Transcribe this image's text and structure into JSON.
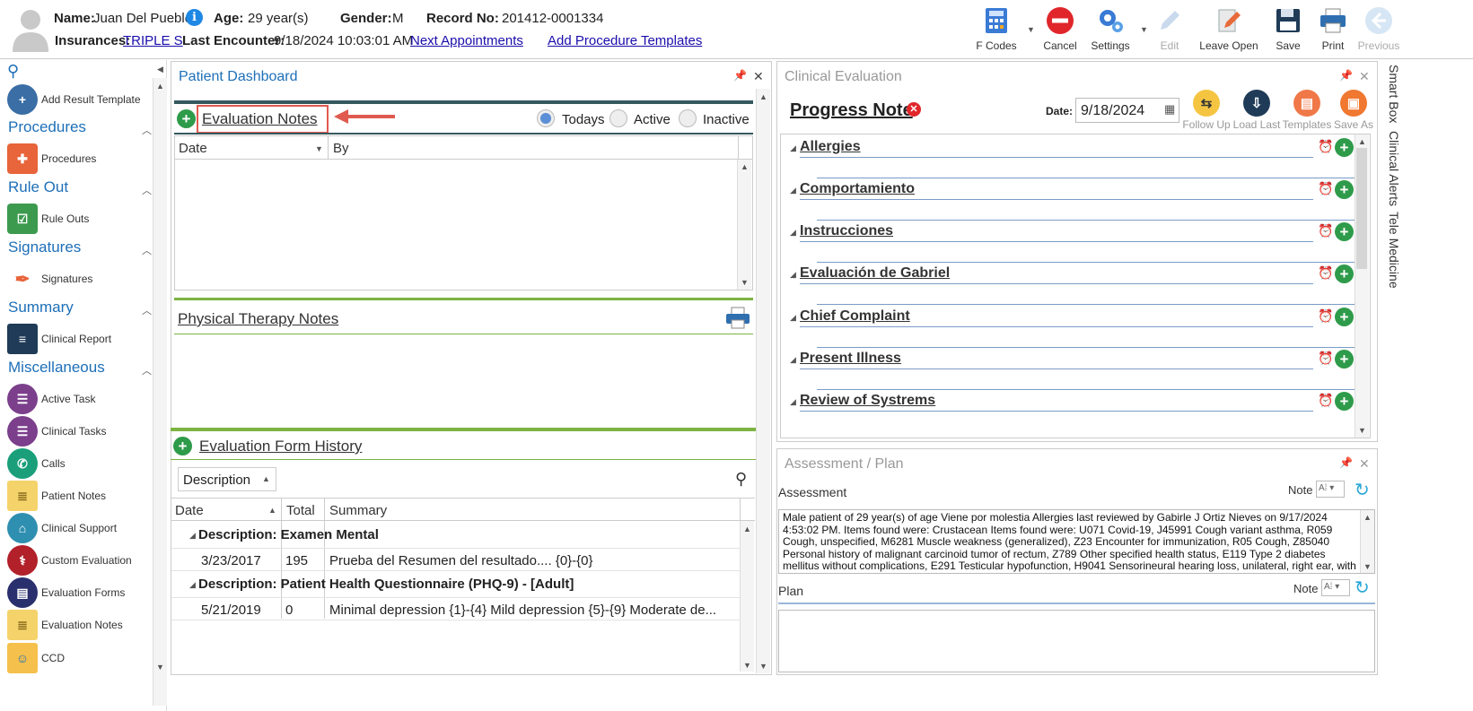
{
  "header": {
    "name_label": "Name:",
    "name": "Juan Del Pueblo",
    "age_label": "Age:",
    "age": "29 year(s)",
    "gender_label": "Gender:",
    "gender": "M",
    "record_label": "Record No:",
    "record": "201412-0001334",
    "insurances_label": "Insurances:",
    "insurance": "TRIPLE S",
    "last_encounter_label": "Last Encounter:",
    "last_encounter": "9/18/2024 10:03:01 AM",
    "next_appointments": "Next Appointments",
    "add_procedure_templates": "Add Procedure Templates"
  },
  "toolbar": {
    "fcodes": "F Codes",
    "cancel": "Cancel",
    "settings": "Settings",
    "edit": "Edit",
    "leave_open": "Leave Open",
    "save": "Save",
    "print": "Print",
    "previous": "Previous"
  },
  "sidebar": {
    "add_result_template": "Add Result Template",
    "sections": [
      {
        "title": "Procedures",
        "item": "Procedures"
      },
      {
        "title": "Rule Out",
        "item": "Rule Outs"
      },
      {
        "title": "Signatures",
        "item": "Signatures"
      },
      {
        "title": "Summary",
        "item": "Clinical Report"
      },
      {
        "title": "Miscellaneous",
        "item": "Active Task"
      }
    ],
    "misc_items": [
      "Clinical Tasks",
      "Calls",
      "Patient Notes",
      "Clinical Support",
      "Custom Evaluation",
      "Evaluation Forms",
      "Evaluation Notes",
      "CCD"
    ]
  },
  "dashboard": {
    "title": "Patient Dashboard",
    "evaluation_notes": "Evaluation Notes",
    "filter_todays": "Todays",
    "filter_active": "Active",
    "filter_inactive": "Inactive",
    "col_date": "Date",
    "col_by": "By",
    "physical_therapy_notes": "Physical Therapy Notes",
    "evaluation_form_history": "Evaluation Form History",
    "group_dropdown": "Description",
    "hist_col_date": "Date",
    "hist_col_total": "Total",
    "hist_col_summary": "Summary",
    "groups": [
      {
        "label": "Description: Examen Mental",
        "date": "3/23/2017",
        "total": "195",
        "summary": "Prueba del Resumen del resultado.... {0}-{0}"
      },
      {
        "label": "Description: Patient Health Questionnaire (PHQ-9) - [Adult]",
        "date": "5/21/2019",
        "total": "0",
        "summary": "Minimal depression {1}-{4}  Mild depression {5}-{9}  Moderate de..."
      }
    ]
  },
  "clinical": {
    "title": "Clinical Evaluation",
    "note_title": "Progress Note",
    "date_label": "Date:",
    "date": "9/18/2024",
    "follow_up": "Follow Up",
    "load_last": "Load Last",
    "templates": "Templates",
    "save_as": "Save As",
    "sections": [
      "Allergies",
      "Comportamiento",
      "Instrucciones",
      "Evaluación de Gabriel",
      "Chief Complaint",
      "Present Illness",
      "Review of Systrems"
    ]
  },
  "assessment": {
    "title": "Assessment / Plan",
    "assessment_label": "Assessment",
    "note_label": "Note",
    "assessment_text": "Male patient of 29 year(s) of age Viene por molestia     Allergies last reviewed by Gabirle J Ortiz Nieves on 9/17/2024 4:53:02 PM.    Items found were:  Crustacean  Items found were:  U071 Covid-19, J45991 Cough variant asthma, R059 Cough, unspecified, M6281 Muscle weakness (generalized), Z23 Encounter for immunization, R05 Cough, Z85040 Personal history of malignant carcinoid tumor of rectum, Z789 Other specified health status, E119 Type 2 diabetes mellitus without complications, E291 Testicular hypofunction, H9041 Sensorineural hearing loss, unilateral, right ear, with",
    "plan_label": "Plan",
    "plan_note_label": "Note"
  },
  "right_tabs": [
    "Smart Box",
    "Clinical Alerts",
    "Tele Medicine"
  ]
}
